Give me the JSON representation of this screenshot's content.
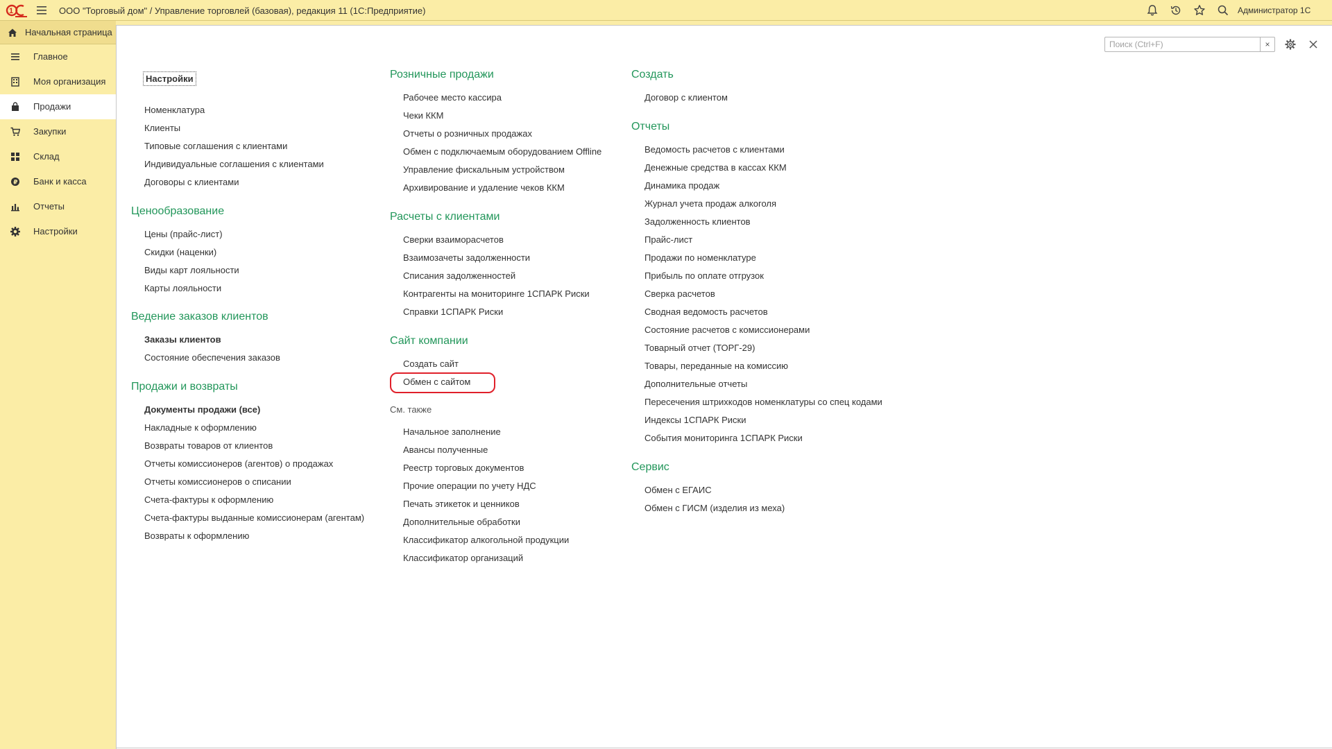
{
  "app": {
    "title": "ООО \"Торговый дом\" / Управление торговлей (базовая), редакция 11  (1С:Предприятие)",
    "user": "Администратор 1С"
  },
  "sidebar": {
    "home_label": "Начальная страница",
    "items": [
      {
        "label": "Главное",
        "icon": "list-icon"
      },
      {
        "label": "Моя организация",
        "icon": "building-icon"
      },
      {
        "label": "Продажи",
        "icon": "bag-icon"
      },
      {
        "label": "Закупки",
        "icon": "cart-icon"
      },
      {
        "label": "Склад",
        "icon": "grid-icon"
      },
      {
        "label": "Банк и касса",
        "icon": "coin-icon"
      },
      {
        "label": "Отчеты",
        "icon": "chart-icon"
      },
      {
        "label": "Настройки",
        "icon": "gear-icon"
      }
    ]
  },
  "search": {
    "placeholder": "Поиск (Ctrl+F)",
    "clear": "×"
  },
  "col1": {
    "settings_label": "Настройки",
    "top_links": [
      "Номенклатура",
      "Клиенты",
      "Типовые соглашения с клиентами",
      "Индивидуальные соглашения с клиентами",
      "Договоры с клиентами"
    ],
    "pricing": {
      "title": "Ценообразование",
      "links": [
        "Цены (прайс-лист)",
        "Скидки (наценки)",
        "Виды карт лояльности",
        "Карты лояльности"
      ]
    },
    "orders": {
      "title": "Ведение заказов клиентов",
      "links": [
        "Заказы клиентов",
        "Состояние обеспечения заказов"
      ]
    },
    "sales": {
      "title": "Продажи и возвраты",
      "links": [
        "Документы продажи (все)",
        "Накладные к оформлению",
        "Возвраты товаров от клиентов",
        "Отчеты комиссионеров (агентов) о продажах",
        "Отчеты комиссионеров о списании",
        "Счета-фактуры к оформлению",
        "Счета-фактуры выданные комиссионерам (агентам)",
        "Возвраты к оформлению"
      ]
    }
  },
  "col2": {
    "retail": {
      "title": "Розничные продажи",
      "links": [
        "Рабочее место кассира",
        "Чеки ККМ",
        "Отчеты о розничных продажах",
        "Обмен с подключаемым оборудованием Offline",
        "Управление фискальным устройством",
        "Архивирование и удаление чеков ККМ"
      ]
    },
    "settlements": {
      "title": "Расчеты с клиентами",
      "links": [
        "Сверки взаиморасчетов",
        "Взаимозачеты задолженности",
        "Списания задолженностей",
        "Контрагенты на мониторинге 1СПАРК Риски",
        "Справки 1СПАРК Риски"
      ]
    },
    "site": {
      "title": "Сайт компании",
      "links": [
        "Создать сайт",
        "Обмен с сайтом"
      ]
    },
    "see_also": {
      "title": "См. также",
      "links": [
        "Начальное заполнение",
        "Авансы полученные",
        "Реестр торговых документов",
        "Прочие операции по учету НДС",
        "Печать этикеток и ценников",
        "Дополнительные обработки",
        "Классификатор алкогольной продукции",
        "Классификатор организаций"
      ]
    }
  },
  "col3": {
    "create": {
      "title": "Создать",
      "links": [
        "Договор с клиентом"
      ]
    },
    "reports": {
      "title": "Отчеты",
      "links": [
        "Ведомость расчетов с клиентами",
        "Денежные средства в кассах ККМ",
        "Динамика продаж",
        "Журнал учета продаж алкоголя",
        "Задолженность клиентов",
        "Прайс-лист",
        "Продажи по номенклатуре",
        "Прибыль по оплате отгрузок",
        "Сверка расчетов",
        "Сводная ведомость расчетов",
        "Состояние расчетов с комиссионерами",
        "Товарный отчет (ТОРГ-29)",
        "Товары, переданные на комиссию",
        "Дополнительные отчеты",
        "Пересечения штрихкодов номенклатуры со спец кодами",
        "Индексы 1СПАРК Риски",
        "События мониторинга 1СПАРК Риски"
      ]
    },
    "service": {
      "title": "Сервис",
      "links": [
        "Обмен с ЕГАИС",
        "Обмен с ГИСМ (изделия из меха)"
      ]
    }
  },
  "colors": {
    "accent_green": "#22965a",
    "background_yellow": "#fbeda6",
    "highlight_red": "#e0202a"
  }
}
